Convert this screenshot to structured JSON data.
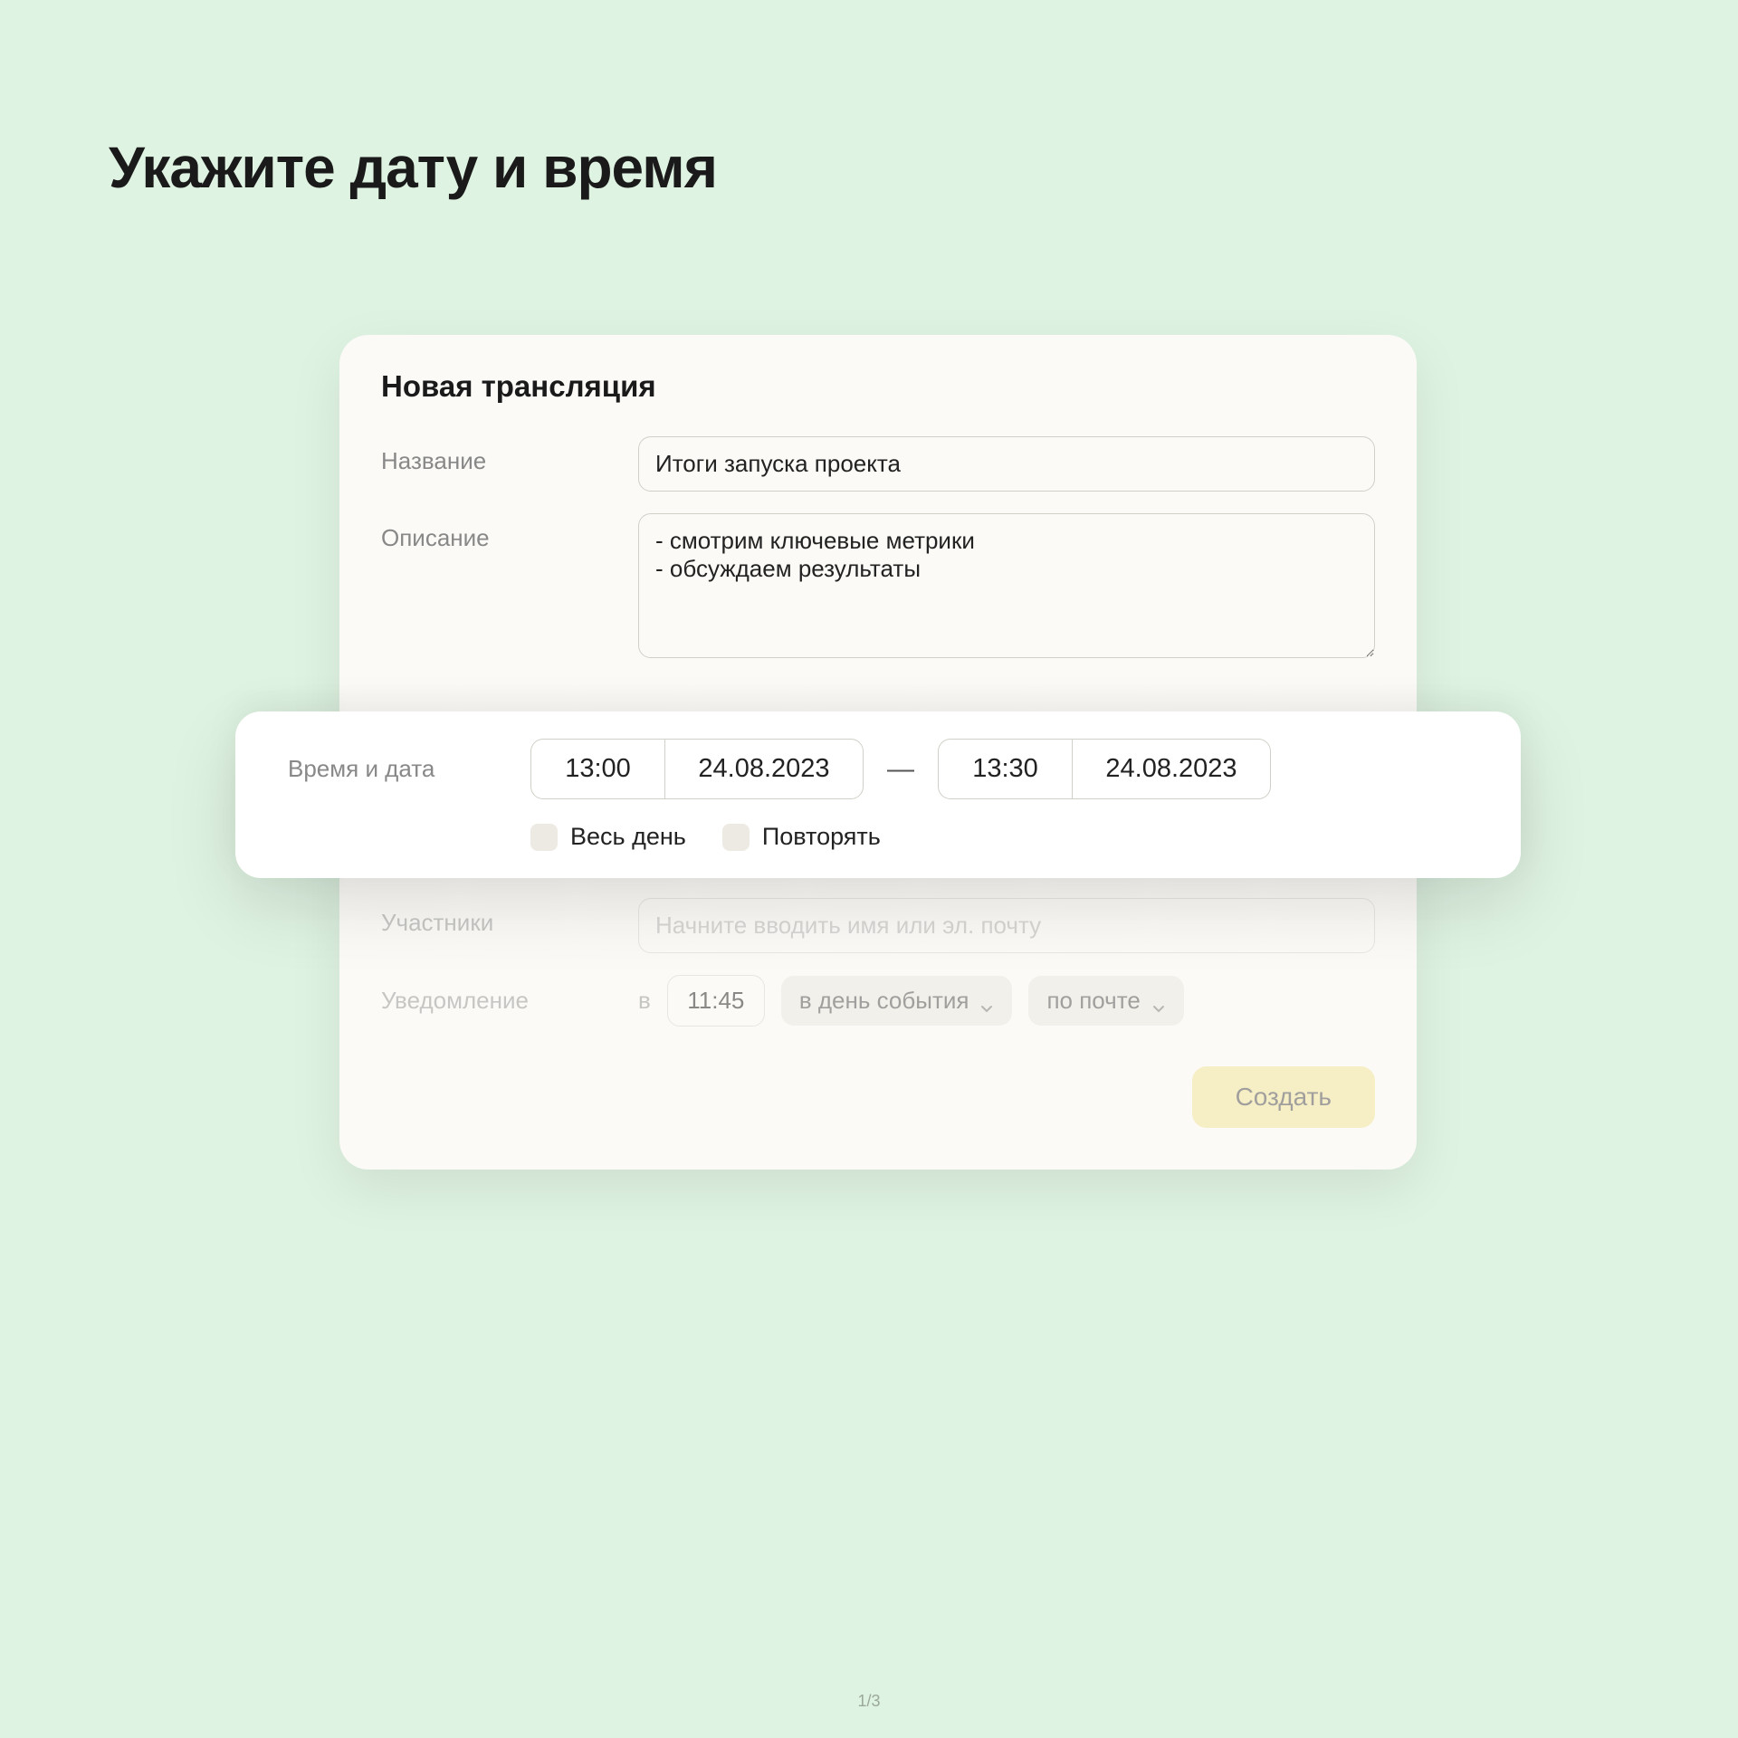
{
  "page": {
    "title": "Укажите дату и время",
    "counter": "1/3"
  },
  "modal": {
    "title": "Новая трансляция",
    "name_label": "Название",
    "name_value": "Итоги запуска проекта",
    "desc_label": "Описание",
    "desc_value": "- смотрим ключевые метрики\n- обсуждаем результаты",
    "participants_label": "Участники",
    "participants_placeholder": "Начните вводить имя или эл. почту",
    "notify_label": "Уведомление",
    "notify_at": "в",
    "notify_time": "11:45",
    "notify_when": "в день события",
    "notify_how": "по почте",
    "create_button": "Создать"
  },
  "datetime": {
    "label": "Время и дата",
    "start_time": "13:00",
    "start_date": "24.08.2023",
    "dash": "—",
    "end_time": "13:30",
    "end_date": "24.08.2023",
    "allday_label": "Весь день",
    "repeat_label": "Повторять"
  }
}
